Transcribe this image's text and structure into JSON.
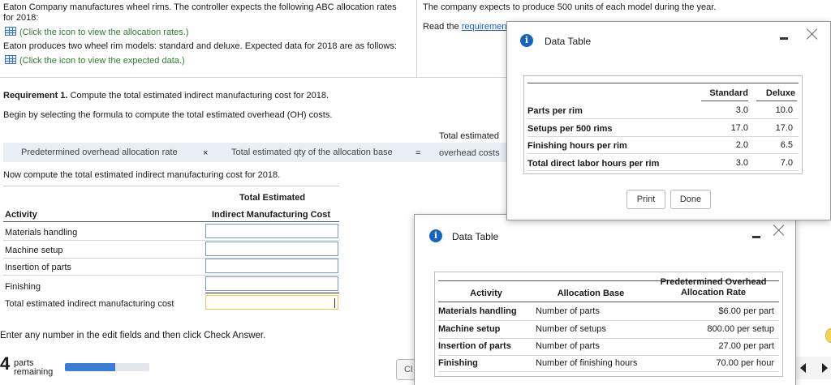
{
  "problem": {
    "intro_line1": "Eaton Company manufactures wheel rims. The controller  expects the following ABC allocation rates",
    "intro_line2": "for 2018:",
    "rates_link": "(Click the icon to view the allocation rates.)",
    "products_text": "Eaton produces two wheel rim models: standard and deluxe. Expected data for 2018 are as follows:",
    "expected_link": "(Click the icon to view the expected data.)",
    "units_text": "The company expects to produce 500 units of each model during the year.",
    "read_prefix": "Read the ",
    "read_link": "requiremen"
  },
  "requirement": {
    "label": "Requirement 1.",
    "text": " Compute the total estimated indirect manufacturing cost for 2018.",
    "formula_prompt": "Begin by selecting the formula to compute the total estimated overhead (OH) costs.",
    "formula_left": "Predetermined overhead allocation rate",
    "times": "×",
    "formula_mid": "Total estimated qty of the allocation base",
    "equals": "=",
    "result_line1": "Total estimated",
    "result_line2": "overhead costs",
    "compute_prompt": "Now compute the total estimated indirect manufacturing cost for 2018."
  },
  "cost_table": {
    "header_top": "Total Estimated",
    "col_activity": "Activity",
    "col_cost": "Indirect Manufacturing Cost",
    "rows": [
      "Materials handling",
      "Machine setup",
      "Insertion of parts",
      "Finishing"
    ],
    "total_label": "Total estimated indirect manufacturing cost"
  },
  "footer": {
    "instruction": "Enter any number in the edit fields and then click Check Answer.",
    "parts_count": "4",
    "parts_line1": "parts",
    "parts_line2": "remaining",
    "progress_fraction": 0.6,
    "clear_btn": "Cl"
  },
  "dialog_expected": {
    "title": "Data Table",
    "col_standard": "Standard",
    "col_deluxe": "Deluxe",
    "rows": [
      {
        "label": "Parts per rim",
        "standard": "3.0",
        "deluxe": "10.0"
      },
      {
        "label": "Setups per 500 rims",
        "standard": "17.0",
        "deluxe": "17.0"
      },
      {
        "label": "Finishing hours per rim",
        "standard": "2.0",
        "deluxe": "6.5"
      },
      {
        "label": "Total direct labor hours per rim",
        "standard": "3.0",
        "deluxe": "7.0"
      }
    ],
    "print_btn": "Print",
    "done_btn": "Done"
  },
  "dialog_rates": {
    "title": "Data Table",
    "col_activity": "Activity",
    "col_base": "Allocation Base",
    "col_rate_line1": "Predetermined Overhead",
    "col_rate_line2": "Allocation Rate",
    "rows": [
      {
        "activity": "Materials handling",
        "base": "Number of parts",
        "rate": "$6.00 per part"
      },
      {
        "activity": "Machine setup",
        "base": "Number of setups",
        "rate": "800.00 per setup"
      },
      {
        "activity": "Insertion of parts",
        "base": "Number of parts",
        "rate": "27.00 per part"
      },
      {
        "activity": "Finishing",
        "base": "Number of finishing hours",
        "rate": "70.00 per hour"
      }
    ]
  },
  "colors": {
    "accent": "#1565c0",
    "link_green": "#2e7d32",
    "input_border": "#6f9ad6",
    "progress": "#3a7bd5"
  }
}
